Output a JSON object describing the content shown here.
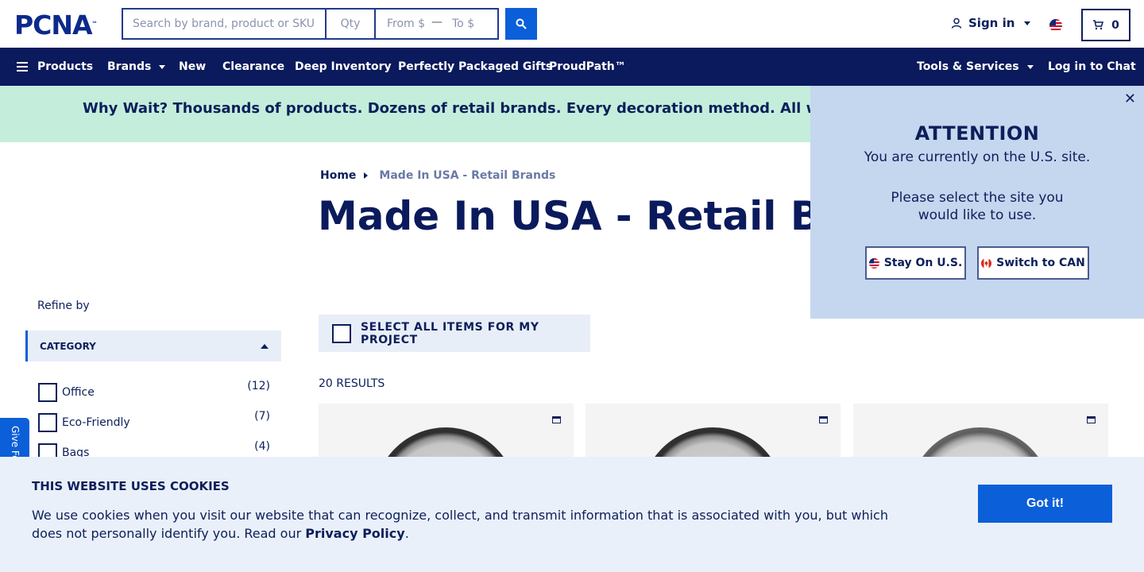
{
  "header": {
    "logo_text": "PCNA",
    "logo_tm": "™",
    "search_placeholder": "Search by brand, product or SKU",
    "qty_placeholder": "Qty",
    "from_placeholder": "From $",
    "dash": "—",
    "to_placeholder": "To $",
    "signin_label": "Sign in",
    "cart_count": "0"
  },
  "nav": {
    "items": [
      {
        "label": "Products"
      },
      {
        "label": "Brands"
      },
      {
        "label": "New"
      },
      {
        "label": "Clearance"
      },
      {
        "label": "Deep Inventory"
      },
      {
        "label": "Perfectly Packaged Gifts"
      },
      {
        "label": "ProudPath™"
      }
    ],
    "tools_label": "Tools & Services",
    "chat_label": "Log in to Chat"
  },
  "promo": {
    "text": "Why Wait? Thousands of products. Dozens of retail brands. Every decoration method. All with a standard"
  },
  "breadcrumb": {
    "home": "Home",
    "current": "Made In USA - Retail Brands"
  },
  "page_title": "Made In USA - Retail Brands",
  "sidebar": {
    "refine_label": "Refine by",
    "category_header": "CATEGORY",
    "filters": [
      {
        "label": "Office",
        "count": "(12)"
      },
      {
        "label": "Eco-Friendly",
        "count": "(7)"
      },
      {
        "label": "Bags",
        "count": "(4)"
      }
    ]
  },
  "listing": {
    "select_all_label": "SELECT ALL ITEMS FOR MY PROJECT",
    "results_label": "20 RESULTS"
  },
  "feedback_label": "Give Feedback",
  "attention": {
    "title": "ATTENTION",
    "line1": "You are currently on the U.S. site.",
    "line2": "Please select the site you would like to use.",
    "stay_label": "Stay On U.S.",
    "switch_label": "Switch to CAN",
    "close_symbol": "✕"
  },
  "cookies": {
    "title": "THIS WEBSITE USES COOKIES",
    "text_before": "We use cookies when you visit our website that can recognize, collect, and transmit information that is associated with you, but which does not personally identify you. Read our ",
    "link_label": "Privacy Policy",
    "text_after": ".",
    "button_label": "Got it!"
  },
  "colors": {
    "navy": "#0a1a5c",
    "accent_blue": "#0b5fd8",
    "promo_green": "#c4eedb",
    "popup_blue": "#c5d6ef",
    "cookie_bg": "#eaf0f9"
  },
  "icons": {
    "search_button": "search-icon",
    "signin": "user-icon",
    "cart": "cart-icon",
    "menu": "hamburger-icon",
    "card_action": "folder-icon",
    "region": "us-flag-icon"
  }
}
